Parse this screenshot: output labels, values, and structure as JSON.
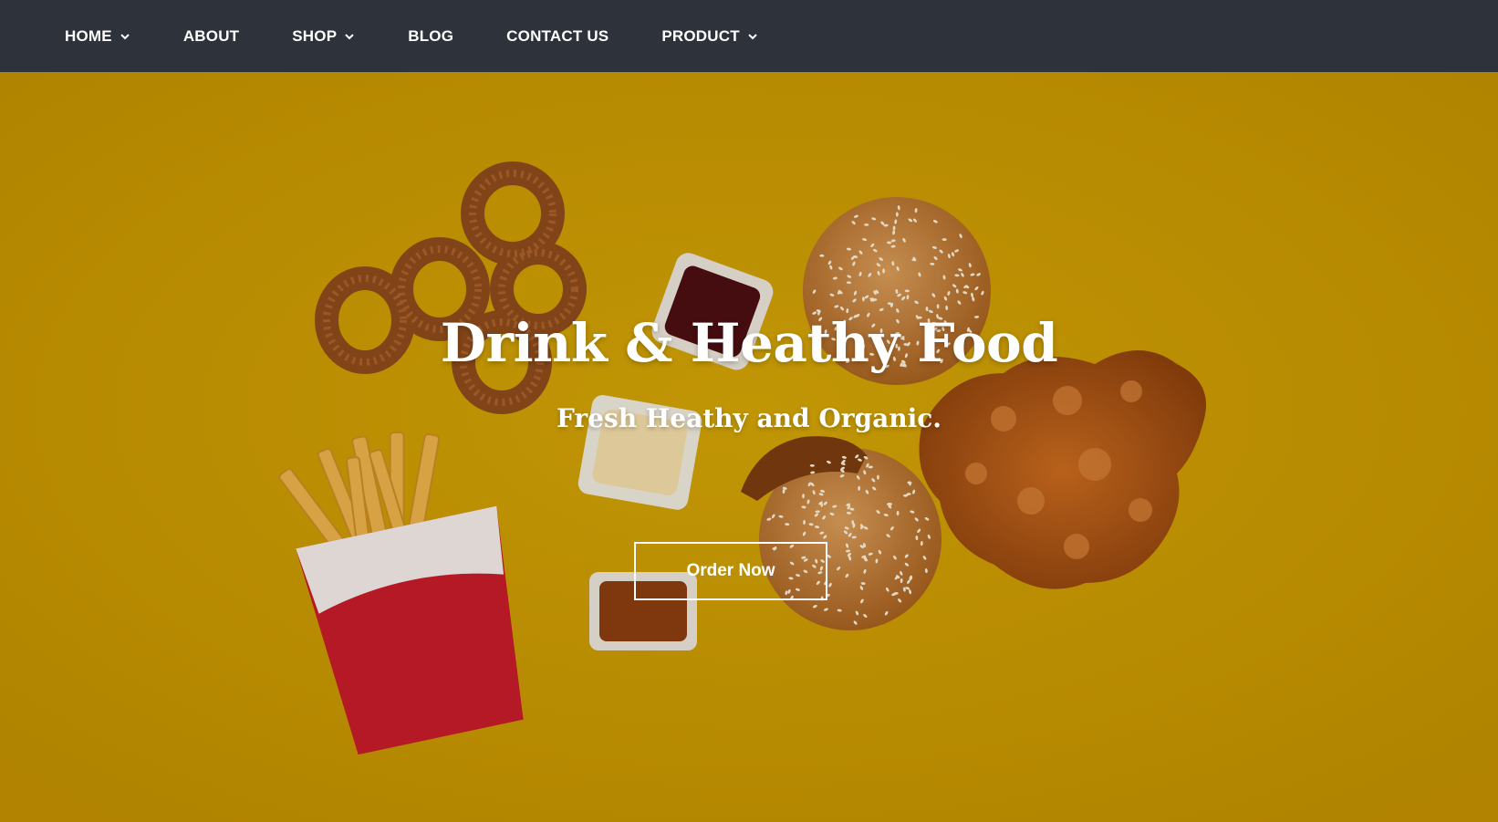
{
  "nav": {
    "items": [
      {
        "label": "HOME",
        "has_dropdown": true
      },
      {
        "label": "ABOUT",
        "has_dropdown": false
      },
      {
        "label": "SHOP",
        "has_dropdown": true
      },
      {
        "label": "BLOG",
        "has_dropdown": false
      },
      {
        "label": "CONTACT US",
        "has_dropdown": false
      },
      {
        "label": "PRODUCT",
        "has_dropdown": true
      }
    ]
  },
  "hero": {
    "title": "Drink & Heathy Food",
    "subtitle": "Fresh Heathy and Organic.",
    "cta_label": "Order Now"
  },
  "colors": {
    "navbar_bg": "#2d323b",
    "hero_bg": "#c99a02",
    "text": "#ffffff"
  }
}
